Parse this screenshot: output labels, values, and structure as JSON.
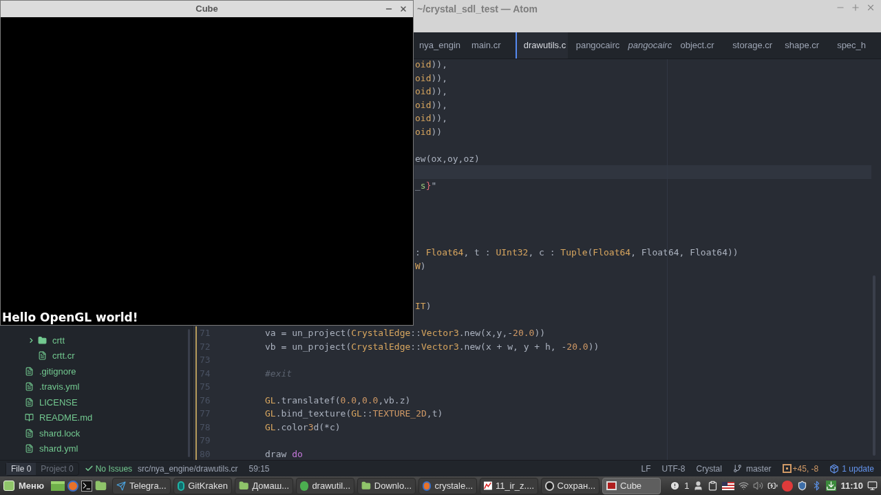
{
  "atom_window": {
    "title": "~/crystal_sdl_test — Atom"
  },
  "tabs": [
    {
      "label": "nya_engin",
      "selected": false,
      "italic": false
    },
    {
      "label": "main.cr",
      "selected": false,
      "italic": false
    },
    {
      "label": "drawutils.c",
      "selected": true,
      "italic": false
    },
    {
      "label": "pangocairc",
      "selected": false,
      "italic": false
    },
    {
      "label": "pangocairc",
      "selected": false,
      "italic": true
    },
    {
      "label": "object.cr",
      "selected": false,
      "italic": false
    },
    {
      "label": "storage.cr",
      "selected": false,
      "italic": false
    },
    {
      "label": "shape.cr",
      "selected": false,
      "italic": false
    },
    {
      "label": "spec_h",
      "selected": false,
      "italic": false
    }
  ],
  "sidebar": {
    "items": [
      {
        "children": [
          {
            "name": "crtt",
            "kind": "folder",
            "expanded": false
          },
          {
            "name": "crtt.cr",
            "kind": "file"
          }
        ]
      },
      {
        "name": ".gitignore",
        "kind": "file"
      },
      {
        "name": ".travis.yml",
        "kind": "file"
      },
      {
        "name": "LICENSE",
        "kind": "file"
      },
      {
        "name": "README.md",
        "kind": "book"
      },
      {
        "name": "shard.lock",
        "kind": "file"
      },
      {
        "name": "shard.yml",
        "kind": "file"
      }
    ]
  },
  "editor": {
    "lines": [
      {
        "current": false,
        "tokens": [
          {
            "text": "oid",
            "kind": "type"
          },
          {
            "text": ")),",
            "kind": "plain"
          }
        ]
      },
      {
        "current": false,
        "tokens": [
          {
            "text": "oid",
            "kind": "type"
          },
          {
            "text": ")),",
            "kind": "plain"
          }
        ]
      },
      {
        "current": false,
        "tokens": [
          {
            "text": "oid",
            "kind": "type"
          },
          {
            "text": ")),",
            "kind": "plain"
          }
        ]
      },
      {
        "current": false,
        "tokens": [
          {
            "text": "oid",
            "kind": "type"
          },
          {
            "text": ")),",
            "kind": "plain"
          }
        ]
      },
      {
        "current": false,
        "tokens": [
          {
            "text": "oid",
            "kind": "type"
          },
          {
            "text": ")),",
            "kind": "plain"
          }
        ]
      },
      {
        "current": false,
        "tokens": [
          {
            "text": "oid",
            "kind": "type"
          },
          {
            "text": "))",
            "kind": "plain"
          }
        ]
      },
      {
        "current": false
      },
      {
        "current": false,
        "tokens": [
          {
            "text": "ew(ox,oy,oz)",
            "kind": "plain"
          }
        ]
      },
      {
        "current": true
      },
      {
        "current": false,
        "tokens": [
          {
            "text": "_",
            "kind": "plain"
          },
          {
            "text": "s",
            "kind": "string"
          },
          {
            "text": "}",
            "kind": "interp"
          },
          {
            "text": "\"",
            "kind": "plain"
          }
        ]
      },
      {
        "current": false
      },
      {
        "current": false
      },
      {
        "current": false
      },
      {
        "current": false
      },
      {
        "current": false,
        "tokens": [
          {
            "text": ": ",
            "kind": "plain"
          },
          {
            "text": "Float64",
            "kind": "type"
          },
          {
            "text": ", t : ",
            "kind": "plain"
          },
          {
            "text": "UInt32",
            "kind": "type"
          },
          {
            "text": ", c : ",
            "kind": "plain"
          },
          {
            "text": "Tuple",
            "kind": "type"
          },
          {
            "text": "(",
            "kind": "plain"
          },
          {
            "text": "Float64",
            "kind": "type"
          },
          {
            "text": ", Float64, Float64))",
            "kind": "plain"
          }
        ]
      },
      {
        "current": false,
        "tokens": [
          {
            "text": "W",
            "kind": "type"
          },
          {
            "text": ")",
            "kind": "plain"
          }
        ]
      },
      {
        "current": false
      },
      {
        "current": false
      },
      {
        "current": false,
        "tokens": [
          {
            "text": "IT",
            "kind": "type"
          },
          {
            "text": ")",
            "kind": "plain"
          }
        ]
      },
      {
        "current": false
      },
      {
        "current": false,
        "number": "71",
        "changed": true,
        "tokens": [
          {
            "text": "va = un_project(",
            "kind": "plain"
          },
          {
            "text": "CrystalEdge",
            "kind": "type"
          },
          {
            "text": "::",
            "kind": "plain"
          },
          {
            "text": "Vector3",
            "kind": "type"
          },
          {
            "text": ".new(x,y,-",
            "kind": "plain"
          },
          {
            "text": "20.0",
            "kind": "number"
          },
          {
            "text": "))",
            "kind": "plain"
          }
        ]
      },
      {
        "current": false,
        "number": "72",
        "changed": true,
        "tokens": [
          {
            "text": "vb = un_project(",
            "kind": "plain"
          },
          {
            "text": "CrystalEdge",
            "kind": "type"
          },
          {
            "text": "::",
            "kind": "plain"
          },
          {
            "text": "Vector3",
            "kind": "type"
          },
          {
            "text": ".new(x + w, y + h, -",
            "kind": "plain"
          },
          {
            "text": "20.0",
            "kind": "number"
          },
          {
            "text": "))",
            "kind": "plain"
          }
        ]
      },
      {
        "current": false,
        "number": "73",
        "changed": true
      },
      {
        "current": false,
        "number": "74",
        "changed": true,
        "tokens": [
          {
            "text": "#exit",
            "kind": "comment"
          }
        ]
      },
      {
        "current": false,
        "number": "75",
        "changed": true
      },
      {
        "current": false,
        "number": "76",
        "changed": true,
        "tokens": [
          {
            "text": "GL",
            "kind": "type"
          },
          {
            "text": ".translatef(",
            "kind": "plain"
          },
          {
            "text": "0.0",
            "kind": "number"
          },
          {
            "text": ",",
            "kind": "plain"
          },
          {
            "text": "0.0",
            "kind": "number"
          },
          {
            "text": ",vb.z)",
            "kind": "plain"
          }
        ]
      },
      {
        "current": false,
        "number": "77",
        "changed": true,
        "tokens": [
          {
            "text": "GL",
            "kind": "type"
          },
          {
            "text": ".bind_texture(",
            "kind": "plain"
          },
          {
            "text": "GL",
            "kind": "type"
          },
          {
            "text": "::",
            "kind": "plain"
          },
          {
            "text": "TEXTURE_2D",
            "kind": "number"
          },
          {
            "text": ",t)",
            "kind": "plain"
          }
        ]
      },
      {
        "current": false,
        "number": "78",
        "changed": true,
        "tokens": [
          {
            "text": "GL",
            "kind": "type"
          },
          {
            "text": ".color",
            "kind": "plain"
          },
          {
            "text": "3",
            "kind": "number"
          },
          {
            "text": "d(*c)",
            "kind": "plain"
          }
        ]
      },
      {
        "current": false,
        "number": "79",
        "changed": true
      },
      {
        "current": false,
        "number": "80",
        "changed": true,
        "tokens": [
          {
            "text": "draw ",
            "kind": "plain"
          },
          {
            "text": "do",
            "kind": "keyword"
          }
        ]
      }
    ]
  },
  "status_bar": {
    "scopes": [
      {
        "label": "File 0",
        "selected": true
      },
      {
        "label": "Project 0",
        "selected": false
      }
    ],
    "issues": "No Issues",
    "path": "src/nya_engine/drawutils.cr",
    "cursor": "59:15",
    "line_ending": "LF",
    "encoding": "UTF-8",
    "grammar": "Crystal",
    "branch": "master",
    "diff": "+45, -8",
    "updates": "1 update"
  },
  "cube_window": {
    "title": "Cube",
    "text": "Hello OpenGL world!"
  },
  "taskbar": {
    "menu": "Меню",
    "windows": [
      {
        "label": "Telegra...",
        "kind": "plane",
        "selected": false
      },
      {
        "label": "GitKraken",
        "kind": "kraken",
        "selected": false
      },
      {
        "label": "Домаш...",
        "kind": "folder",
        "selected": false
      },
      {
        "label": "drawutil...",
        "kind": "orb",
        "selected": false
      },
      {
        "label": "Downlo...",
        "kind": "folder",
        "selected": false
      },
      {
        "label": "crystale...",
        "kind": "fox",
        "selected": false
      },
      {
        "label": "11_ir_z....",
        "kind": "chart",
        "selected": false
      },
      {
        "label": "Сохран...",
        "kind": "disc",
        "selected": false
      },
      {
        "label": "Cube",
        "kind": "cube",
        "selected": true
      }
    ],
    "notifications": "1",
    "clock": "11:10"
  }
}
